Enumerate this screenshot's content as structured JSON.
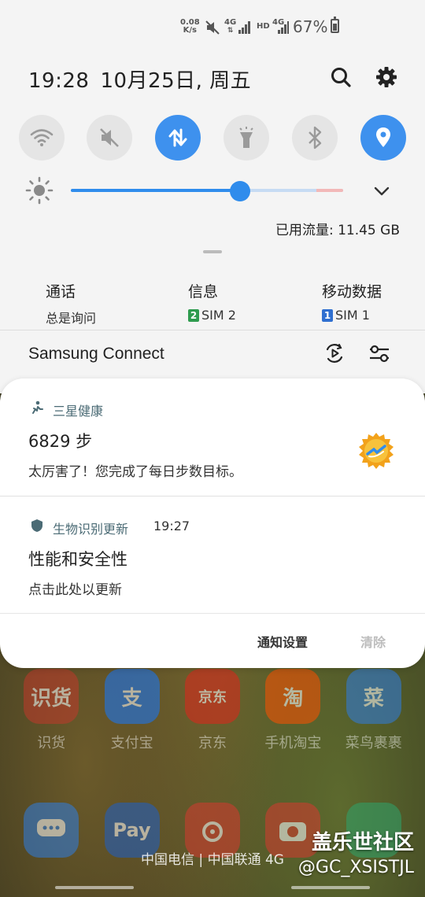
{
  "status_bar": {
    "net_speed_value": "0.08",
    "net_speed_unit": "K/s",
    "network_1": "4G",
    "network_2_hd": "HD",
    "network_2": "4G",
    "battery": "67%"
  },
  "header": {
    "time": "19:28",
    "date": "10月25日, 周五"
  },
  "quick_settings": [
    {
      "name": "wifi",
      "icon": "wifi-icon",
      "on": false
    },
    {
      "name": "sound",
      "icon": "mute-icon",
      "on": false
    },
    {
      "name": "mobile-data",
      "icon": "data-transfer-icon",
      "on": true
    },
    {
      "name": "flashlight",
      "icon": "flashlight-icon",
      "on": false
    },
    {
      "name": "bluetooth",
      "icon": "bluetooth-icon",
      "on": false
    },
    {
      "name": "location",
      "icon": "location-icon",
      "on": true
    }
  ],
  "brightness": {
    "level": 0.62
  },
  "data_usage": "已用流量: 11.45 GB",
  "sim_settings": {
    "calls": {
      "title": "通话",
      "value": "总是询问"
    },
    "messages": {
      "title": "信息",
      "sim_num": "2",
      "value": "SIM 2"
    },
    "mobile_data": {
      "title": "移动数据",
      "sim_num": "1",
      "value": "SIM 1"
    }
  },
  "samsung_connect": {
    "title": "Samsung Connect"
  },
  "notifications": [
    {
      "app": "三星健康",
      "title": "6829 步",
      "text": "太厉害了！您完成了每日步数目标。"
    },
    {
      "app": "生物识别更新",
      "time": "19:27",
      "title": "性能和安全性",
      "text": "点击此处以更新"
    }
  ],
  "notif_footer": {
    "settings": "通知设置",
    "clear": "清除"
  },
  "home_apps": [
    {
      "label": "识货",
      "icon_text": "识货",
      "color": "#c0392b"
    },
    {
      "label": "支付宝",
      "icon_text": "支",
      "color": "#1677ff"
    },
    {
      "label": "京东",
      "icon_text": "京东",
      "color": "#e1251b"
    },
    {
      "label": "手机淘宝",
      "icon_text": "淘",
      "color": "#ff5000"
    },
    {
      "label": "菜鸟裹裹",
      "icon_text": "菜",
      "color": "#2f7de1"
    }
  ],
  "dock_apps": [
    {
      "label": "messages",
      "color": "#2f7de1"
    },
    {
      "label": "pay",
      "icon_text": "Pay",
      "color": "#1e5fc7"
    },
    {
      "label": "music",
      "color": "#d63a2f"
    },
    {
      "label": "camera",
      "color": "#d63a2f"
    },
    {
      "label": "phone",
      "color": "#2ea46b"
    }
  ],
  "carrier": "中国电信 | 中国联通 4G",
  "watermark": {
    "line1": "盖乐世社区",
    "line2": "@GC_XSISTJL"
  }
}
